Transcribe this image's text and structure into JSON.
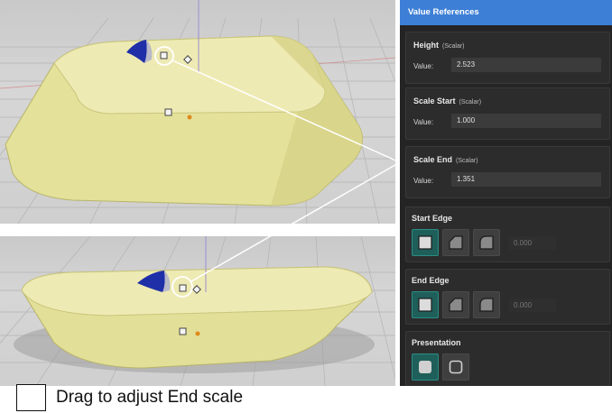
{
  "panel": {
    "title": "Value References",
    "height": {
      "label": "Height",
      "type": "(Scalar)",
      "value_label": "Value:",
      "value": "2.523"
    },
    "scale_start": {
      "label": "Scale Start",
      "type": "(Scalar)",
      "value_label": "Value:",
      "value": "1.000"
    },
    "scale_end": {
      "label": "Scale End",
      "type": "(Scalar)",
      "value_label": "Value:",
      "value": "1.351"
    },
    "start_edge": {
      "label": "Start Edge",
      "value": "0.000",
      "options": [
        "square-edge-icon",
        "chamfer-edge-icon",
        "round-edge-icon"
      ],
      "selected": 0
    },
    "end_edge": {
      "label": "End Edge",
      "value": "0.000",
      "options": [
        "square-edge-icon",
        "chamfer-edge-icon",
        "round-edge-icon"
      ],
      "selected": 0
    },
    "presentation": {
      "label": "Presentation",
      "options": [
        "solid-icon",
        "outline-icon"
      ],
      "selected": 0
    }
  },
  "caption": {
    "text": "Drag to adjust End scale"
  },
  "colors": {
    "header": "#3d7fd6",
    "panel_bg": "#242424",
    "active_button": "#1f5f5a",
    "model_fill": "#e6e39c",
    "handle_accent": "#e08a1e"
  }
}
